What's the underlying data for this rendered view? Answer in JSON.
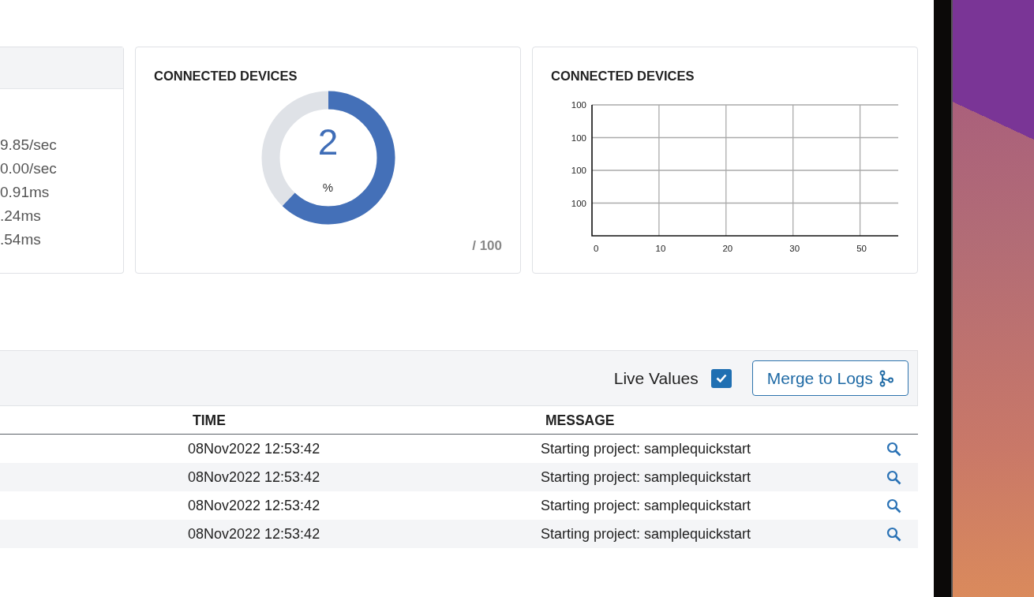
{
  "metrics_card": {
    "values": [
      "9.85/sec",
      "0.00/sec",
      "0.91ms",
      ".24ms",
      ".54ms"
    ]
  },
  "donut_card": {
    "title": "CONNECTED DEVICES",
    "value": "2",
    "unit": "%",
    "level": 0.62,
    "max": "/ 100"
  },
  "chart_card": {
    "title": "CONNECTED DEVICES",
    "y_labels": [
      "100",
      "100",
      "100",
      "100"
    ],
    "x_labels": [
      "0",
      "10",
      "20",
      "30",
      "50"
    ]
  },
  "toolbar": {
    "live_values": {
      "label": "Live Values",
      "checked": true
    },
    "merge_button": "Merge to Logs"
  },
  "table": {
    "columns": [
      "TIME",
      "MESSAGE"
    ],
    "rows": [
      {
        "time": "08Nov2022 12:53:42",
        "message": "Starting project: samplequickstart"
      },
      {
        "time": "08Nov2022 12:53:42",
        "message": "Starting project: samplequickstart"
      },
      {
        "time": "08Nov2022 12:53:42",
        "message": "Starting project: samplequickstart"
      },
      {
        "time": "08Nov2022 12:53:42",
        "message": "Starting project: samplequickstart"
      }
    ]
  }
}
